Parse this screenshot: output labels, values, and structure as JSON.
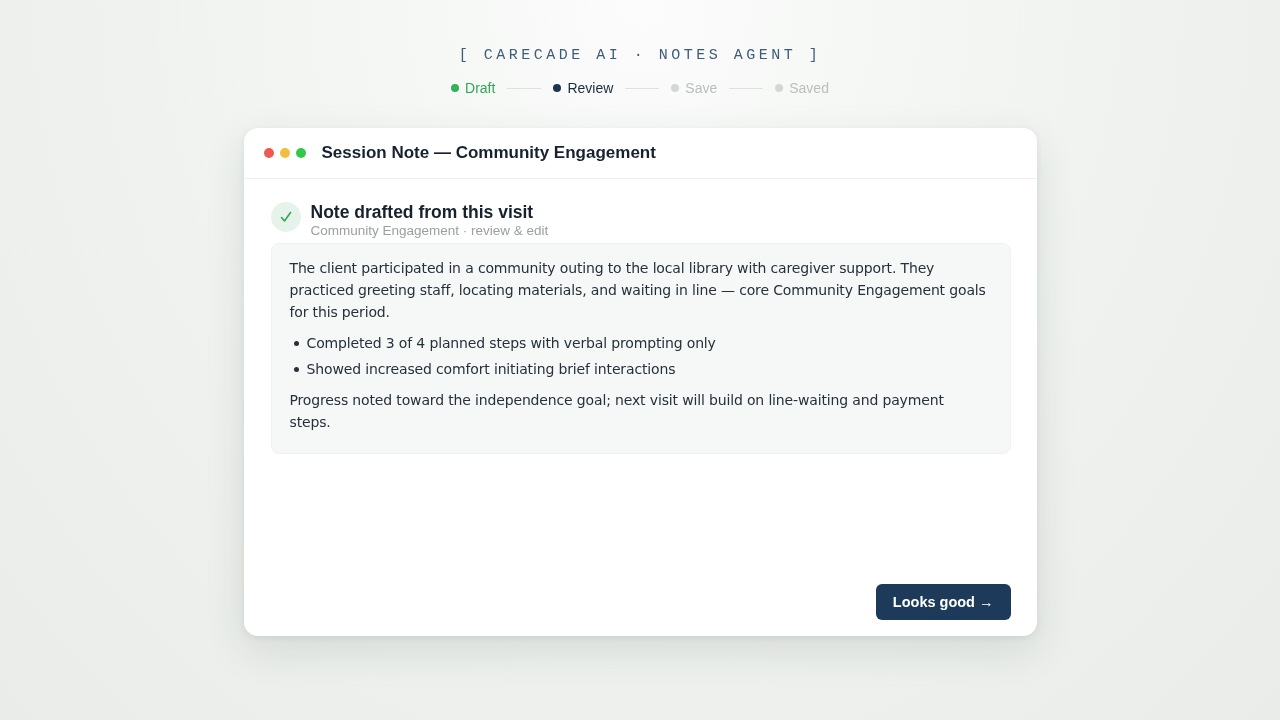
{
  "brand": "[ CARECADE AI · NOTES AGENT ]",
  "steps": [
    {
      "label": "Draft",
      "done": true,
      "selected": false
    },
    {
      "label": "Review",
      "done": false,
      "selected": true
    },
    {
      "label": "Save",
      "done": false,
      "selected": false
    },
    {
      "label": "Saved",
      "done": false,
      "selected": false
    }
  ],
  "window": {
    "title": "Session Note — Community Engagement"
  },
  "status": {
    "heading": "Note drafted from this visit",
    "subtitle": "Community Engagement · review & edit"
  },
  "note": {
    "blocks": [
      {
        "kind": "paragraph",
        "text": "The client participated in a community outing to the local library with caregiver support. They practiced greeting staff, locating materials, and waiting in line — core Community Engagement goals for this period."
      },
      {
        "kind": "bullets",
        "items": [
          "Completed 3 of 4 planned steps with verbal prompting only",
          "Showed increased comfort initiating brief interactions"
        ]
      },
      {
        "kind": "paragraph",
        "text": "Progress noted toward the independence goal; next visit will build on line-waiting and payment steps."
      }
    ]
  },
  "actions": {
    "primary": "Looks good →"
  }
}
